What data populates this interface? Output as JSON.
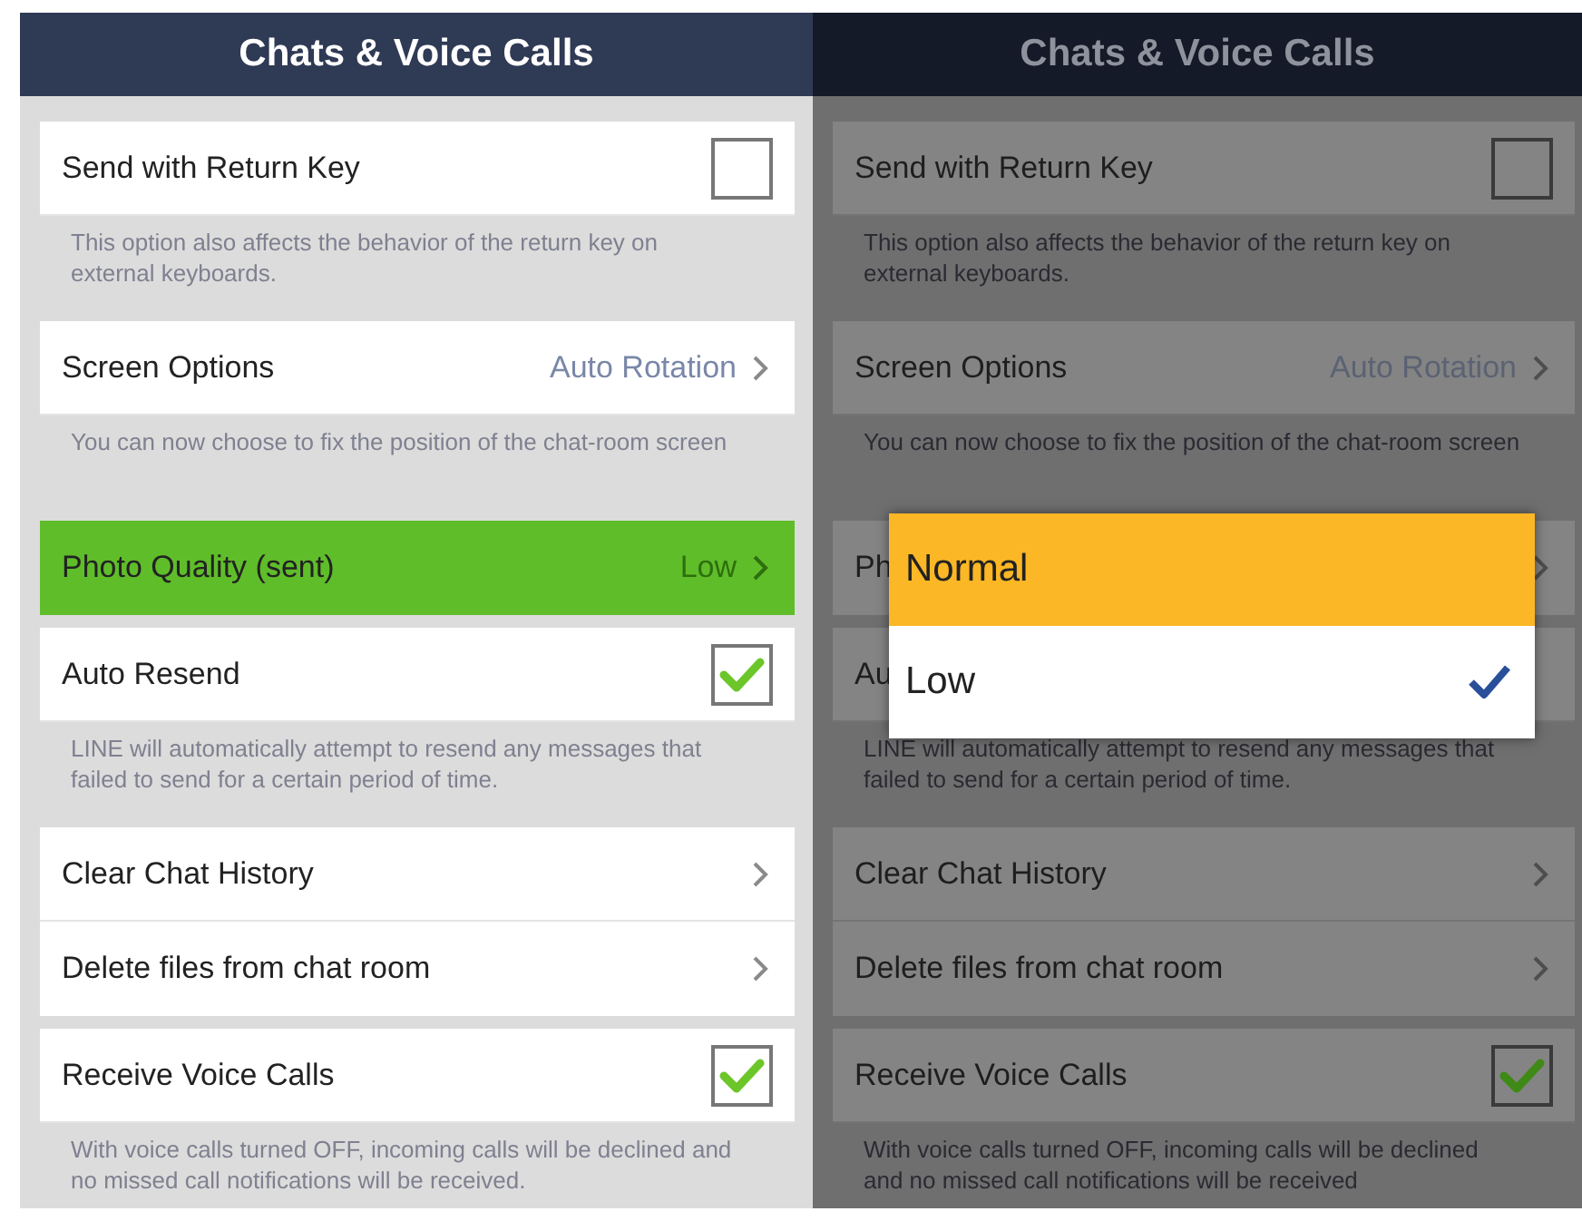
{
  "screens": [
    {
      "title": "Chats & Voice Calls",
      "dimmed": false,
      "groups": [
        {
          "rows": [
            {
              "kind": "checkbox",
              "label": "Send with Return Key",
              "checked": false
            }
          ],
          "note": "This option also affects the behavior of the return key on external keyboards."
        },
        {
          "rows": [
            {
              "kind": "link",
              "label": "Screen Options",
              "value": "Auto Rotation",
              "pressed": false
            }
          ],
          "note": "You can now choose to fix the position of the chat-room screen"
        },
        {
          "rows": [
            {
              "kind": "link",
              "label": "Photo Quality (sent)",
              "value": "Low",
              "pressed": true
            }
          ]
        },
        {
          "rows": [
            {
              "kind": "checkbox",
              "label": "Auto Resend",
              "checked": true
            }
          ],
          "note": "LINE will automatically attempt to resend any messages that failed to send for a certain period of time."
        },
        {
          "rows": [
            {
              "kind": "link",
              "label": "Clear Chat History",
              "pressed": false
            },
            {
              "kind": "link",
              "label": "Delete files from chat room",
              "pressed": false
            }
          ]
        },
        {
          "rows": [
            {
              "kind": "checkbox",
              "label": "Receive Voice Calls",
              "checked": true
            }
          ],
          "note": "With voice calls turned OFF, incoming calls will be declined and no missed call notifications will be received."
        }
      ]
    },
    {
      "title": "Chats & Voice Calls",
      "dimmed": true,
      "groups": [
        {
          "rows": [
            {
              "kind": "checkbox",
              "label": "Send with Return Key",
              "checked": false
            }
          ],
          "note": "This option also affects the behavior of the return key on external keyboards."
        },
        {
          "rows": [
            {
              "kind": "link",
              "label": "Screen Options",
              "value": "Auto Rotation",
              "pressed": false
            }
          ],
          "note": "You can now choose to fix the position of the chat-room screen"
        },
        {
          "rows": [
            {
              "kind": "link",
              "label": "Ph",
              "pressed": false
            }
          ]
        },
        {
          "rows": [
            {
              "kind": "plain",
              "label": "Au"
            }
          ],
          "note": "LINE will automatically attempt to resend any messages that failed to send for a certain period of time."
        },
        {
          "rows": [
            {
              "kind": "link",
              "label": "Clear Chat History",
              "pressed": false
            },
            {
              "kind": "link",
              "label": "Delete files from chat room",
              "pressed": false
            }
          ]
        },
        {
          "rows": [
            {
              "kind": "checkbox",
              "label": "Receive Voice Calls",
              "checked": true
            }
          ],
          "note": "With voice calls turned OFF, incoming calls will be declined and no missed call notifications will be received"
        }
      ],
      "dialog": {
        "options": [
          {
            "label": "Normal",
            "selected": false
          },
          {
            "label": "Low",
            "selected": true
          }
        ]
      }
    }
  ]
}
